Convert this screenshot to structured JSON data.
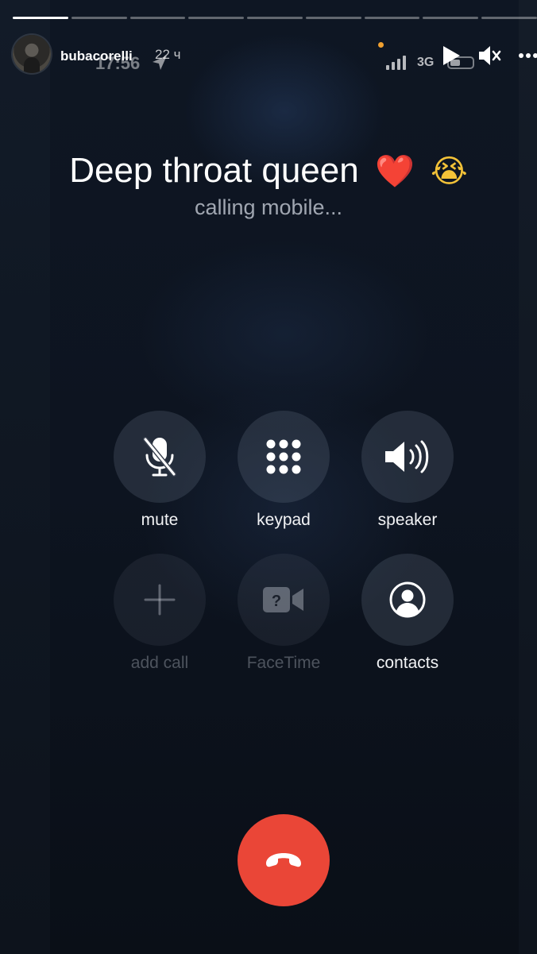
{
  "story": {
    "username": "bubacorelli",
    "time_ago": "22 ч",
    "progress_segments": 9,
    "active_segment": 0
  },
  "status_bar": {
    "time": "17:56",
    "network": "3G"
  },
  "call": {
    "contact_name": "Deep throat queen",
    "emoji_heart": "❤️",
    "emoji_cry": "😭",
    "status": "calling mobile..."
  },
  "buttons": {
    "mute": "mute",
    "keypad": "keypad",
    "speaker": "speaker",
    "add_call": "add call",
    "facetime": "FaceTime",
    "contacts": "contacts"
  },
  "colors": {
    "end_call": "#ea4637",
    "heart": "#e0262b"
  },
  "icons": [
    "location-arrow-icon",
    "signal-icon",
    "battery-icon",
    "play-icon",
    "sound-off-icon",
    "more-icon",
    "mic-slash-icon",
    "keypad-icon",
    "speaker-icon",
    "plus-icon",
    "facetime-icon",
    "contacts-icon",
    "end-call-icon"
  ]
}
